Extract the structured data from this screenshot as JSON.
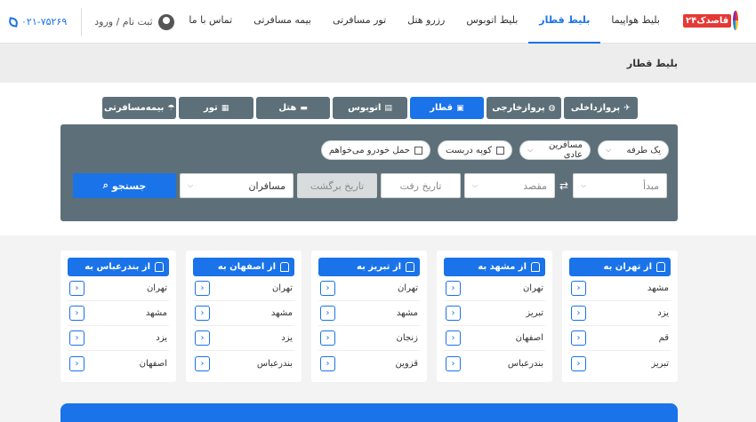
{
  "header": {
    "logo_text": "قاصدک۲۴",
    "nav": [
      {
        "label": "بلیط هواپیما",
        "active": false
      },
      {
        "label": "بلیط قطار",
        "active": true
      },
      {
        "label": "بلیط اتوبوس",
        "active": false
      },
      {
        "label": "رزرو هتل",
        "active": false
      },
      {
        "label": "تور مسافرتی",
        "active": false
      },
      {
        "label": "بیمه مسافرتی",
        "active": false
      },
      {
        "label": "تماس با ما",
        "active": false
      }
    ],
    "login_label": "ثبت نام / ورود",
    "phone": "۰۲۱-۷۵۲۶۹"
  },
  "breadcrumb": "بلیط قطار",
  "tabs": [
    {
      "label": "پروازداخلی",
      "icon": "plane-icon",
      "glyph": "✈"
    },
    {
      "label": "پروازخارجی",
      "icon": "globe-icon",
      "glyph": "◍"
    },
    {
      "label": "قطار",
      "icon": "train-icon",
      "glyph": "▣"
    },
    {
      "label": "اتوبوس",
      "icon": "bus-icon",
      "glyph": "▤"
    },
    {
      "label": "هتل",
      "icon": "bed-icon",
      "glyph": "▬"
    },
    {
      "label": "تور",
      "icon": "suitcase-icon",
      "glyph": "▦"
    },
    {
      "label": "بیمه‌مسافرتی",
      "icon": "umbrella-icon",
      "glyph": "☂"
    }
  ],
  "search": {
    "trip_type": "یک طرفه",
    "passenger_type": "مسافرین عادی",
    "coupe_label": "کوپه دربست",
    "car_label": "حمل خودرو می‌خواهم",
    "origin_placeholder": "مبدأ",
    "destination_placeholder": "مقصد",
    "depart_placeholder": "تاریخ رفت",
    "return_placeholder": "تاریخ برگشت",
    "passengers": "مسافران",
    "search_label": "جستجو",
    "swap_glyph": "⇄",
    "search_glyph": "⌕"
  },
  "route_cards": [
    {
      "title": "از تهران به",
      "cities": [
        "مشهد",
        "یزد",
        "قم",
        "تبریز"
      ]
    },
    {
      "title": "از مشهد به",
      "cities": [
        "تهران",
        "تبریز",
        "اصفهان",
        "بندرعباس"
      ]
    },
    {
      "title": "از تبریز به",
      "cities": [
        "تهران",
        "مشهد",
        "زنجان",
        "قزوین"
      ]
    },
    {
      "title": "از اصفهان به",
      "cities": [
        "تهران",
        "مشهد",
        "یزد",
        "بندرعباس"
      ]
    },
    {
      "title": "از بندرعباس به",
      "cities": [
        "تهران",
        "مشهد",
        "یزد",
        "اصفهان"
      ]
    }
  ],
  "colors": {
    "accent": "#1a73e8",
    "panel": "#5d7079",
    "logo_red": "#e53935"
  }
}
